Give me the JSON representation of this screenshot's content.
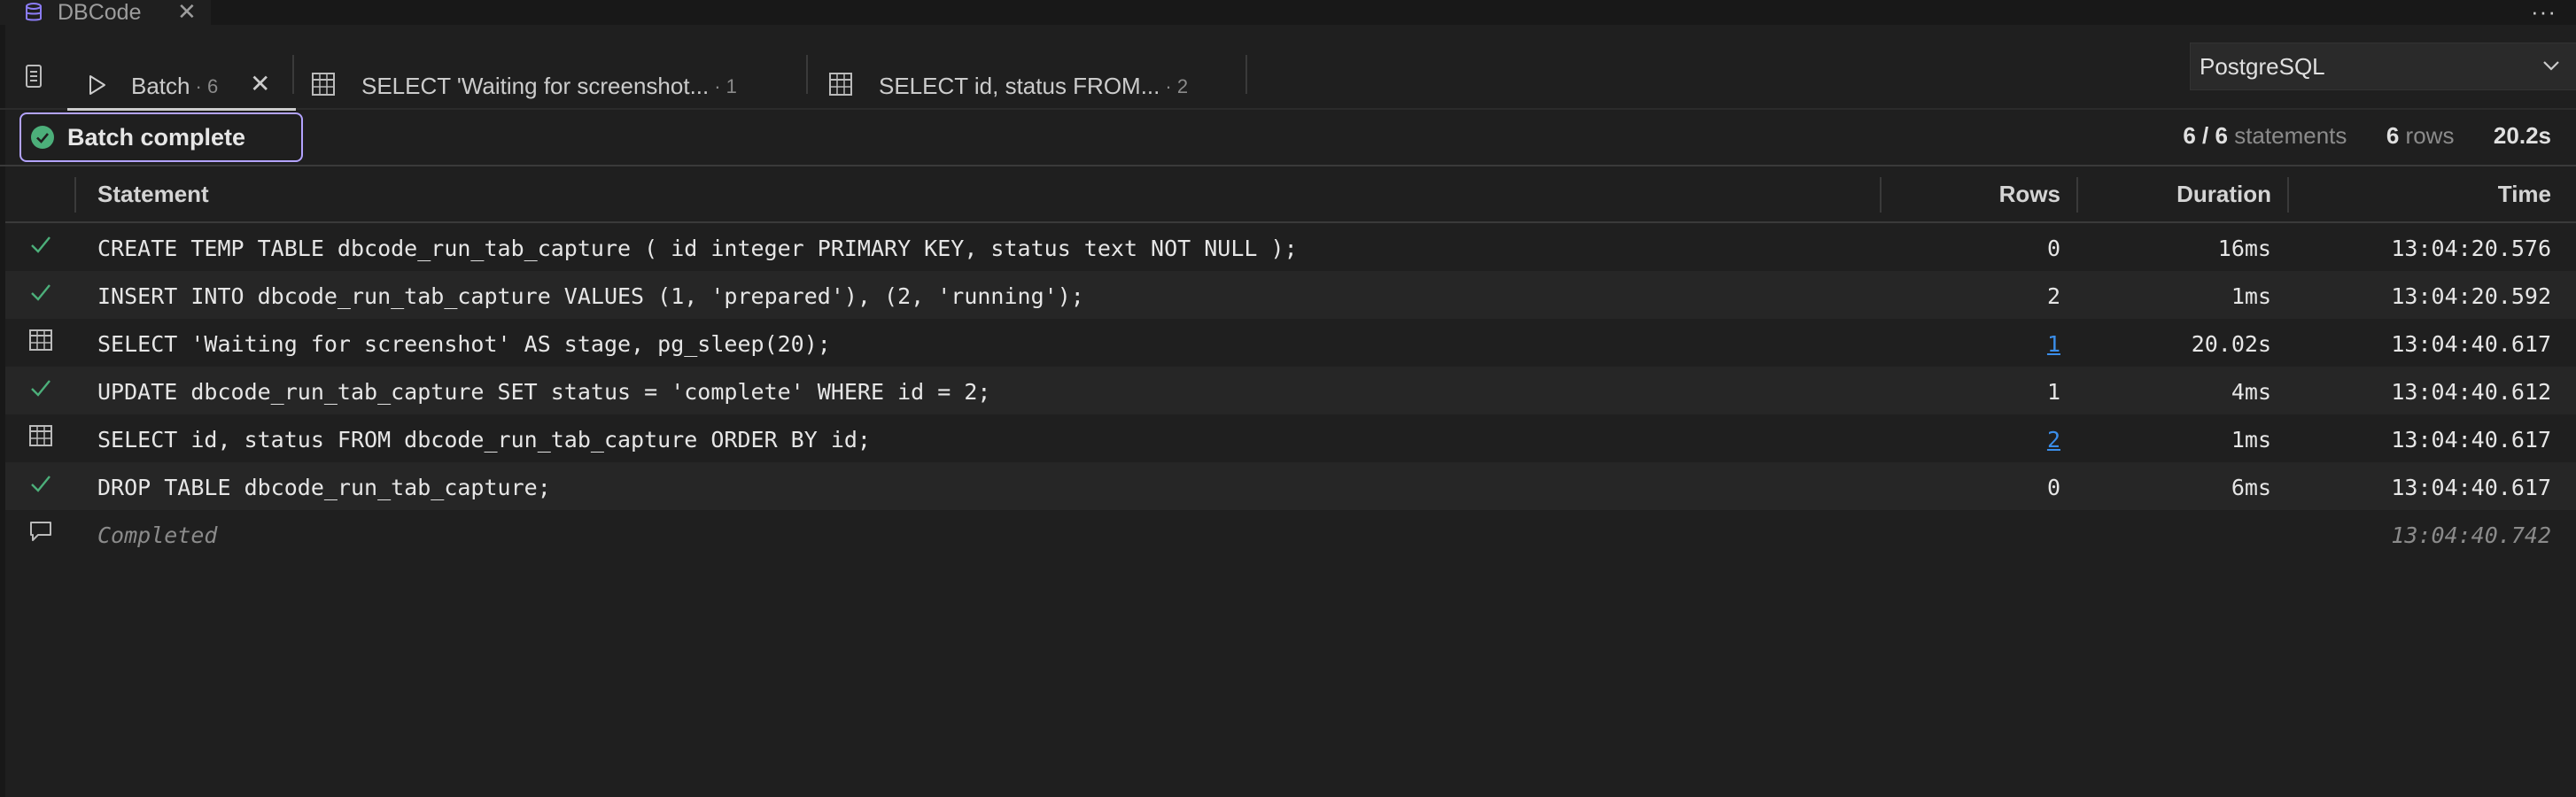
{
  "editor_tab": {
    "title": "DBCode",
    "icon": "database-icon",
    "close_icon": "close-icon"
  },
  "header": {
    "more_icon": "ellipsis-icon",
    "more_label": "···"
  },
  "result_tabs": [
    {
      "label": "Batch",
      "count": "· 6",
      "icon": "play-icon",
      "active": true,
      "close": "✕"
    },
    {
      "label": "SELECT 'Waiting for screenshot...",
      "count": "· 1",
      "icon": "table-icon"
    },
    {
      "label": "SELECT id, status FROM...",
      "count": "· 2",
      "icon": "table-icon"
    }
  ],
  "dialect_select": {
    "value": "PostgreSQL",
    "options": [
      "PostgreSQL"
    ]
  },
  "status": {
    "label": "Batch complete",
    "statements_value": "6 / 6",
    "statements_unit": "statements",
    "rows_value": "6",
    "rows_unit": "rows",
    "elapsed": "20.2s"
  },
  "table": {
    "columns": [
      "Statement",
      "Rows",
      "Duration",
      "Time"
    ],
    "rows": [
      {
        "status_icon": "check-icon",
        "statement": "CREATE TEMP TABLE dbcode_run_tab_capture ( id integer PRIMARY KEY, status text NOT NULL );",
        "rows": "0",
        "rows_link": false,
        "duration": "16ms",
        "time": "13:04:20.576"
      },
      {
        "status_icon": "check-icon",
        "statement": "INSERT INTO dbcode_run_tab_capture VALUES (1, 'prepared'), (2, 'running');",
        "rows": "2",
        "rows_link": false,
        "duration": "1ms",
        "time": "13:04:20.592"
      },
      {
        "status_icon": "table-icon",
        "statement": "SELECT 'Waiting for screenshot' AS stage, pg_sleep(20);",
        "rows": "1",
        "rows_link": true,
        "duration": "20.02s",
        "time": "13:04:40.617"
      },
      {
        "status_icon": "check-icon",
        "statement": "UPDATE dbcode_run_tab_capture SET status = 'complete' WHERE id = 2;",
        "rows": "1",
        "rows_link": false,
        "duration": "4ms",
        "time": "13:04:40.612"
      },
      {
        "status_icon": "table-icon",
        "statement": "SELECT id, status FROM dbcode_run_tab_capture ORDER BY id;",
        "rows": "2",
        "rows_link": true,
        "duration": "1ms",
        "time": "13:04:40.617"
      },
      {
        "status_icon": "check-icon",
        "statement": "DROP TABLE dbcode_run_tab_capture;",
        "rows": "0",
        "rows_link": false,
        "duration": "6ms",
        "time": "13:04:40.617"
      }
    ],
    "footer": {
      "status_icon": "comment-icon",
      "statement": "Completed",
      "time": "13:04:40.742"
    }
  },
  "colors": {
    "accent_border": "#b3a3ff",
    "success": "#4caf7a",
    "link": "#3b8eea",
    "icon_purple": "#8b7cf6"
  }
}
